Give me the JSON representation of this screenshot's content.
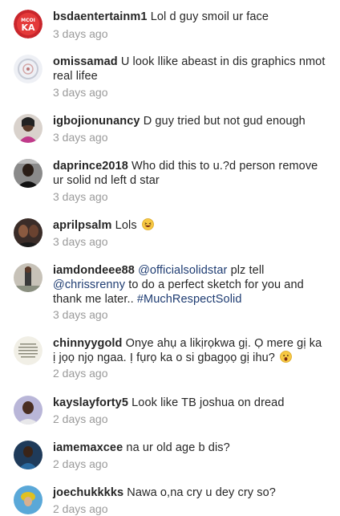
{
  "comments": [
    {
      "username": "bsdaentertainm1",
      "text": "Lol d guy smoil ur face",
      "time": "3 days ago",
      "avatar": "logo-avatar-red"
    },
    {
      "username": "omissamad",
      "text": "U look llike abeast in dis graphics nmot real lifee",
      "time": "3 days ago",
      "avatar": "pattern-avatar"
    },
    {
      "username": "igbojionunancy",
      "text": "D guy tried but not gud enough",
      "time": "3 days ago",
      "avatar": "photo-avatar"
    },
    {
      "username": "daprince2018",
      "text": "Who did this to u.?d person remove ur solid nd left d star",
      "time": "3 days ago",
      "avatar": "photo-avatar"
    },
    {
      "username": "aprilpsalm",
      "text": "Lols",
      "emoji": "laughing-emoji",
      "time": "3 days ago",
      "avatar": "photo-avatar"
    },
    {
      "username": "iamdondeee88",
      "mention1": "@officialsolidstar",
      "text1": " plz tell ",
      "mention2": "@chrissrenny",
      "text2": " to do a perfect sketch for you and thank me later.. ",
      "hashtag": "#MuchRespectSolid",
      "time": "3 days ago",
      "avatar": "photo-avatar"
    },
    {
      "username": "chinnyygold",
      "text": "Onye ahụ a likịrọkwa gị. Ọ mere gị ka ị jọọ njọ ngaa. Ị fụrọ ka o si gbagọọ gị ihu?",
      "emoji": "surprised-emoji",
      "time": "2 days ago",
      "avatar": "text-avatar"
    },
    {
      "username": "kayslayforty5",
      "text": "Look like TB joshua on dread",
      "time": "2 days ago",
      "avatar": "photo-avatar"
    },
    {
      "username": "iamemaxcee",
      "text": "na ur old age b dis?",
      "time": "2 days ago",
      "avatar": "photo-avatar"
    },
    {
      "username": "joechukkkks",
      "text": "Nawa o,na cry u dey cry so?",
      "time": "2 days ago",
      "avatar": "photo-avatar"
    }
  ]
}
